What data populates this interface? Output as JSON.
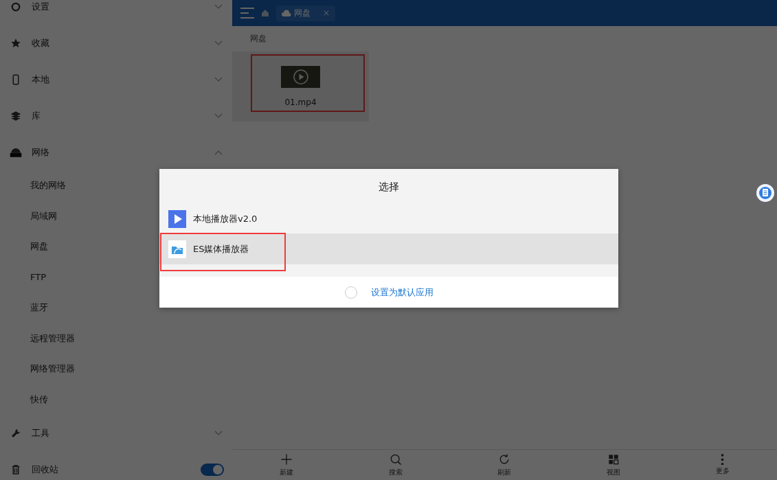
{
  "sidebar": {
    "items": [
      {
        "label": "设置",
        "kind": "settings",
        "expanded": false
      },
      {
        "label": "收藏",
        "kind": "star",
        "expanded": false
      },
      {
        "label": "本地",
        "kind": "phone",
        "expanded": false
      },
      {
        "label": "库",
        "kind": "library",
        "expanded": false
      },
      {
        "label": "网络",
        "kind": "network",
        "expanded": true,
        "children": [
          {
            "label": "我的网络"
          },
          {
            "label": "局域网"
          },
          {
            "label": "网盘"
          },
          {
            "label": "FTP"
          },
          {
            "label": "蓝牙"
          },
          {
            "label": "远程管理器"
          },
          {
            "label": "网络管理器"
          },
          {
            "label": "快传"
          }
        ]
      },
      {
        "label": "工具",
        "kind": "tools",
        "expanded": false
      },
      {
        "label": "回收站",
        "kind": "trash",
        "on": true
      }
    ]
  },
  "top_bar": {
    "tab": "网盘",
    "close": "×"
  },
  "breadcrumb": [
    "网盘"
  ],
  "files": [
    {
      "name": "01.mp4",
      "highlighted": true
    }
  ],
  "dialog": {
    "title": "选择",
    "options": [
      {
        "label": "本地播放器v2.0",
        "kind": "play",
        "selected": false,
        "highlighted": false
      },
      {
        "label": "ES媒体播放器",
        "kind": "es",
        "selected": true,
        "highlighted": true
      }
    ],
    "default_app": {
      "label": "设置为默认应用",
      "checked": false
    }
  },
  "toolbar": [
    {
      "label": "新建",
      "kind": "new"
    },
    {
      "label": "搜索",
      "kind": "search"
    },
    {
      "label": "刷新",
      "kind": "refresh"
    },
    {
      "label": "视图",
      "kind": "view"
    },
    {
      "label": "更多",
      "kind": "more"
    }
  ]
}
